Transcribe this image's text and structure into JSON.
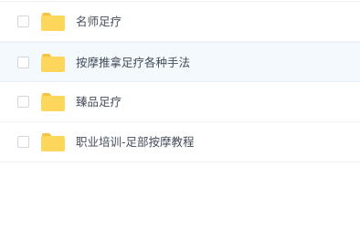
{
  "file_list": {
    "items": [
      {
        "name": "名师足疗",
        "type": "folder",
        "icon": "folder-icon",
        "selected": false,
        "hover": false
      },
      {
        "name": "按摩推拿足疗各种手法",
        "type": "folder",
        "icon": "folder-icon",
        "selected": false,
        "hover": true
      },
      {
        "name": "臻品足疗",
        "type": "folder",
        "icon": "folder-icon",
        "selected": false,
        "hover": false
      },
      {
        "name": "职业培训-足部按摩教程",
        "type": "folder",
        "icon": "folder-icon",
        "selected": false,
        "hover": false
      }
    ]
  },
  "colors": {
    "folder_body": "#ffd65c",
    "folder_tab": "#f5c342",
    "text": "#454d5a",
    "hover_bg": "#f4f9fe",
    "divider": "#f1f3f6",
    "checkbox_border": "#d3d6db"
  }
}
